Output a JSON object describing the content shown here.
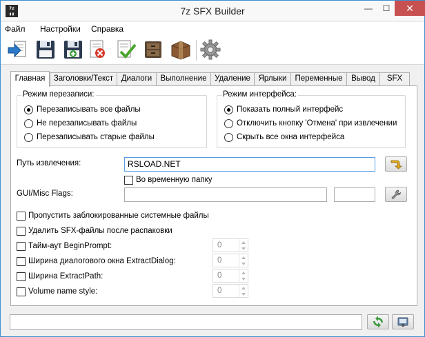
{
  "window": {
    "icon_text": "7z",
    "title": "7z SFX Builder",
    "minimize": "—",
    "maximize": "☐",
    "close": "✕"
  },
  "menu": [
    "Файл",
    "Настройки",
    "Справка"
  ],
  "toolbar": [
    "open",
    "save",
    "save-new",
    "delete",
    "check",
    "build-archive",
    "archive-box",
    "settings"
  ],
  "tabs": [
    "Главная",
    "Заголовки/Текст",
    "Диалоги",
    "Выполнение",
    "Удаление",
    "Ярлыки",
    "Переменные",
    "Вывод",
    "SFX"
  ],
  "active_tab": 0,
  "overwrite_mode": {
    "title": "Режим перезаписи:",
    "options": [
      "Перезаписывать все файлы",
      "Не перезаписывать файлы",
      "Перезаписывать старые файлы"
    ],
    "selected": 0
  },
  "interface_mode": {
    "title": "Режим интерфейса:",
    "options": [
      "Показать полный интерфейс",
      "Отключить кнопку 'Отмена' при извлечении",
      "Скрыть все окна интерфейса"
    ],
    "selected": 0
  },
  "extract_path": {
    "label": "Путь извлечения:",
    "value": "RSLOAD.NET",
    "temp_folder_label": "Во временную папку",
    "temp_folder_checked": false
  },
  "gui_flags": {
    "label": "GUI/Misc Flags:",
    "value": "",
    "value2": ""
  },
  "options": [
    {
      "label": "Пропустить заблокированные системные файлы",
      "checked": false
    },
    {
      "label": "Удалить SFX-файлы после распаковки",
      "checked": false
    }
  ],
  "numeric_options": [
    {
      "label": "Тайм-аут BeginPrompt:",
      "value": "0",
      "checked": false
    },
    {
      "label": "Ширина диалогового окна ExtractDialog:",
      "value": "0",
      "checked": false
    },
    {
      "label": "Ширина ExtractPath:",
      "value": "0",
      "checked": false
    },
    {
      "label": "Volume name style:",
      "value": "0",
      "checked": false
    }
  ],
  "bottom": {
    "input_value": ""
  },
  "colors": {
    "accent": "#3e8fd0",
    "close": "#c75050",
    "toolbar_blue": "#1f5fa8"
  }
}
